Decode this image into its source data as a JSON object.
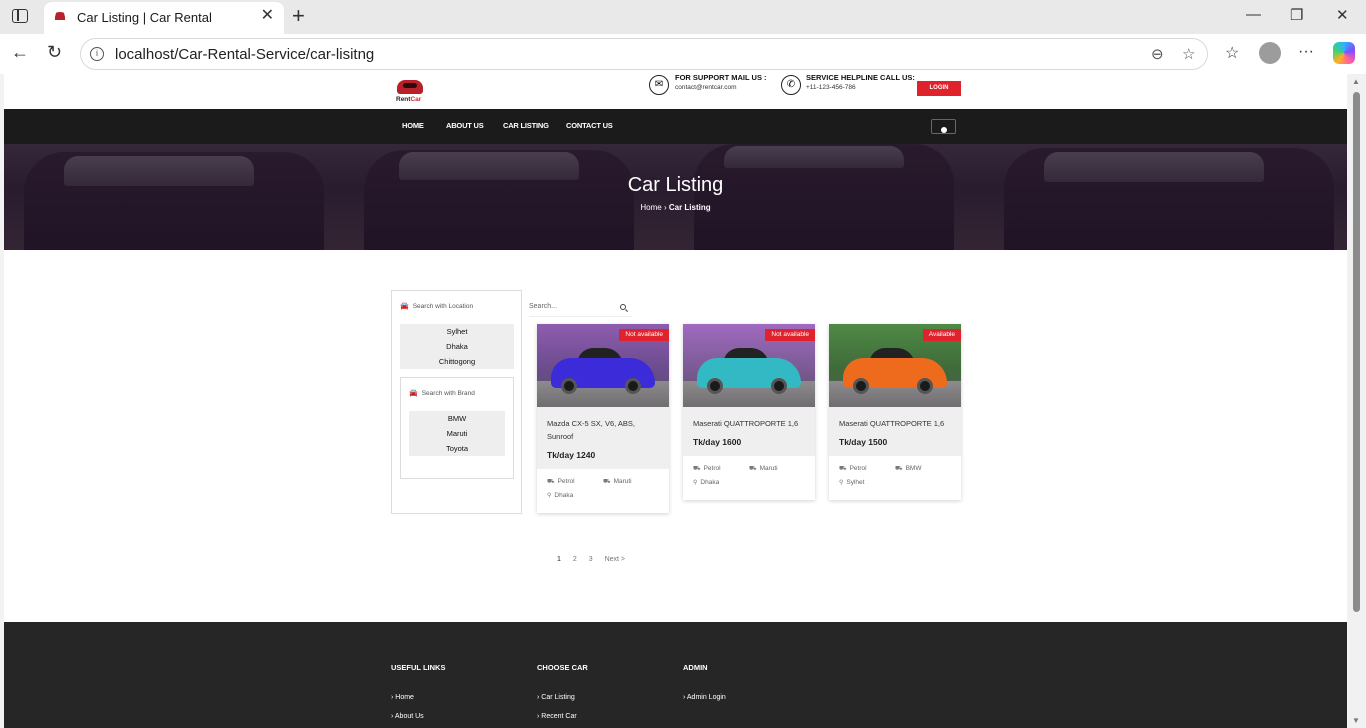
{
  "browser": {
    "tab_title": "Car Listing | Car Rental",
    "url": "localhost/Car-Rental-Service/car-lisitng"
  },
  "header": {
    "logo_prefix": "Rent",
    "logo_suffix": "Car",
    "support_title": "FOR SUPPORT MAIL US :",
    "support_value": "contact@rentcar.com",
    "helpline_title": "SERVICE HELPLINE CALL US:",
    "helpline_value": "+11-123-456-786",
    "login_label": "LOGIN"
  },
  "nav": {
    "items": [
      "HOME",
      "ABOUT US",
      "CAR LISTING",
      "CONTACT US"
    ]
  },
  "hero": {
    "title": "Car Listing",
    "crumb_home": "Home",
    "crumb_sep": "›",
    "crumb_current": "Car Listing"
  },
  "sidebar": {
    "location_title": "Search with Location",
    "locations": [
      "Sylhet",
      "Dhaka",
      "Chittogong"
    ],
    "brand_title": "Search with Brand",
    "brands": [
      "BMW",
      "Maruti",
      "Toyota"
    ]
  },
  "search": {
    "placeholder": "Search..."
  },
  "cars": [
    {
      "status": "Not available",
      "name": "Mazda CX-5 SX, V6, ABS, Sunroof",
      "price": "Tk/day 1240",
      "fuel": "Petrol",
      "brand": "Maruti",
      "location": "Dhaka",
      "color": "#3b2bd8",
      "bg": "#6a4c8c"
    },
    {
      "status": "Not available",
      "name": "Maserati QUATTROPORTE 1,6",
      "price": "Tk/day 1600",
      "fuel": "Petrol",
      "brand": "Maruti",
      "location": "Dhaka",
      "color": "#33b9c4",
      "bg": "#7a5a93"
    },
    {
      "status": "Available",
      "name": "Maserati QUATTROPORTE 1,6",
      "price": "Tk/day 1500",
      "fuel": "Petrol",
      "brand": "BMW",
      "location": "Sylhet",
      "color": "#ee6a1c",
      "bg": "#3f6a3a"
    }
  ],
  "pagination": {
    "pages": [
      "1",
      "2",
      "3"
    ],
    "next": "Next >"
  },
  "footer": {
    "useful_title": "USEFUL LINKS",
    "useful_links": [
      "Home",
      "About Us"
    ],
    "choose_title": "CHOOSE CAR",
    "choose_links": [
      "Car Listing",
      "Recent Car"
    ],
    "admin_title": "ADMIN",
    "admin_links": [
      "Admin Login"
    ]
  },
  "colors": {
    "accent": "#e0222d",
    "nav_bg": "#1b1b1b",
    "footer_bg": "#262626"
  }
}
